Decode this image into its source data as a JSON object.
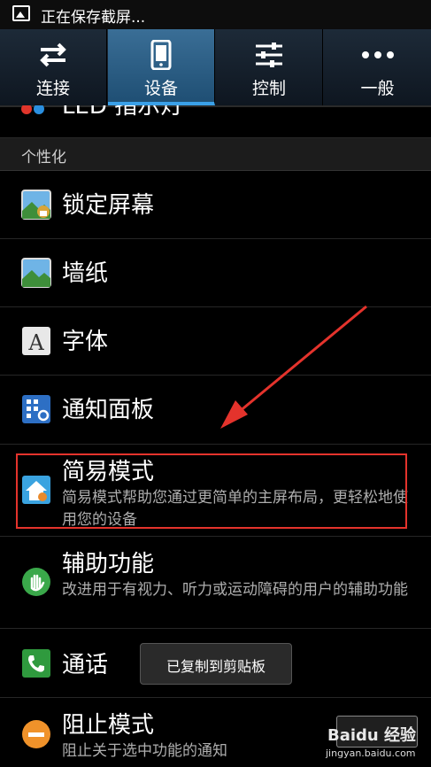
{
  "status_bar": {
    "text": "正在保存截屏..."
  },
  "tabs": [
    {
      "label": "连接",
      "icon": "swap-arrows-icon",
      "active": false
    },
    {
      "label": "设备",
      "icon": "phone-icon",
      "active": true
    },
    {
      "label": "控制",
      "icon": "sliders-icon",
      "active": false
    },
    {
      "label": "一般",
      "icon": "more-dots-icon",
      "active": false
    }
  ],
  "partial_item": {
    "label": "LED 指示灯"
  },
  "section": {
    "label": "个性化"
  },
  "items": [
    {
      "title": "锁定屏幕",
      "icon": "lock-screen-icon"
    },
    {
      "title": "墙纸",
      "icon": "wallpaper-icon"
    },
    {
      "title": "字体",
      "icon": "font-icon"
    },
    {
      "title": "通知面板",
      "icon": "notification-panel-icon"
    },
    {
      "title": "简易模式",
      "desc": "简易模式帮助您通过更简单的主屏布局，更轻松地使用您的设备",
      "icon": "easy-mode-home-icon"
    },
    {
      "title": "辅助功能",
      "desc": "改进用于有视力、听力或运动障碍的用户的辅助功能",
      "icon": "accessibility-hand-icon"
    },
    {
      "title": "通话",
      "icon": "phone-call-icon"
    },
    {
      "title": "阻止模式",
      "desc": "阻止关于选中功能的通知",
      "icon": "blocking-mode-icon"
    }
  ],
  "toast": {
    "text": "已复制到剪贴板"
  },
  "watermark": {
    "text": "Baidu 经验",
    "url": "jingyan.baidu.com"
  },
  "colors": {
    "accent": "#3aa0e8",
    "highlight_box": "#e4332c",
    "arrow": "#e4332c"
  }
}
